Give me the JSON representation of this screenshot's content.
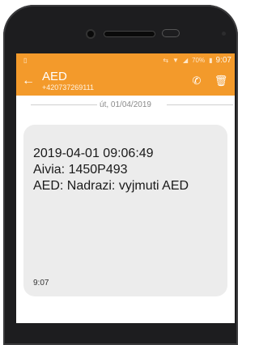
{
  "status_bar": {
    "time": "9:07",
    "battery_percent": "70%",
    "icons": [
      "notification-icon",
      "nfc-icon",
      "wifi-icon",
      "signal-icon",
      "battery-icon"
    ]
  },
  "app_bar": {
    "title": "AED",
    "subtitle": "+420737269111",
    "accent_color": "#f39a2b"
  },
  "conversation": {
    "date_separator": "út, 01/04/2019",
    "message": {
      "lines": [
        "2019-04-01 09:06:49",
        "Aivia: 1450P493",
        "AED: Nadrazi: vyjmuti AED"
      ],
      "time": "9:07"
    }
  }
}
